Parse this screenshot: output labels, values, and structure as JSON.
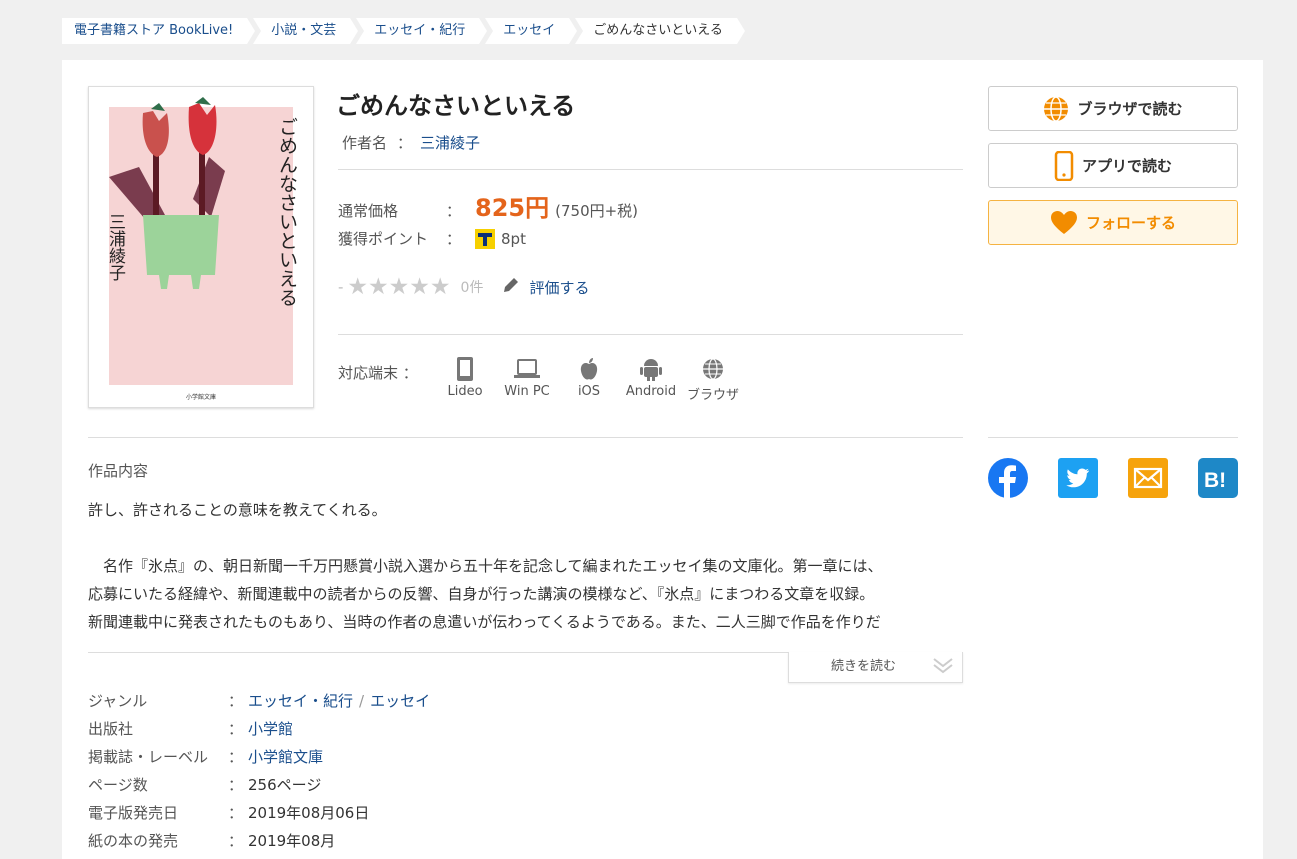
{
  "breadcrumb": [
    "電子書籍ストア BookLive!",
    "小説・文芸",
    "エッセイ・紀行",
    "エッセイ",
    "ごめんなさいといえる"
  ],
  "book": {
    "title": "ごめんなさいといえる",
    "author_label": "作者名",
    "author": "三浦綾子",
    "cover_title": "ごめんなさいといえる",
    "cover_author": "三浦綾子",
    "cover_publisher": "小学館文庫"
  },
  "price": {
    "label": "通常価格",
    "value": "825円",
    "tax": "(750円+税)",
    "points_label": "獲得ポイント",
    "points": "8pt"
  },
  "rating": {
    "dash": "-",
    "stars": "★★★★★",
    "count": "0件",
    "action": "評価する"
  },
  "devices": {
    "label": "対応端末",
    "items": [
      "Lideo",
      "Win PC",
      "iOS",
      "Android",
      "ブラウザ"
    ]
  },
  "description": {
    "heading": "作品内容",
    "lead": "許し、許されることの意味を教えてくれる。",
    "body_1": "名作『氷点』の、朝日新聞一千万円懸賞小説入選から五十年を記念して編まれたエッセイ集の文庫化。第一章には、",
    "body_2": "応募にいたる経緯や、新聞連載中の読者からの反響、自身が行った講演の模様など、『氷点』にまつわる文章を収録。",
    "body_3": "新聞連載中に発表されたものもあり、当時の作者の息遣いが伝わってくるようである。また、二人三脚で作品を作りだ",
    "more": "続きを読む"
  },
  "meta": [
    {
      "key": "ジャンル",
      "values": [
        "エッセイ・紀行",
        "エッセイ"
      ],
      "link": true
    },
    {
      "key": "出版社",
      "values": [
        "小学館"
      ],
      "link": true
    },
    {
      "key": "掲載誌・レーベル",
      "values": [
        "小学館文庫"
      ],
      "link": true
    },
    {
      "key": "ページ数",
      "values": [
        "256ページ"
      ],
      "link": false
    },
    {
      "key": "電子版発売日",
      "values": [
        "2019年08月06日"
      ],
      "link": false
    },
    {
      "key": "紙の本の発売",
      "values": [
        "2019年08月"
      ],
      "link": false
    }
  ],
  "buttons": {
    "browser": "ブラウザで読む",
    "app": "アプリで読む",
    "follow": "フォローする"
  },
  "colon": "：",
  "colors": {
    "accent_price": "#e4641b",
    "link": "#1a4e8c",
    "follow": "#f28c00",
    "facebook": "#1877f2",
    "twitter": "#1da1f2",
    "mail": "#f6a30c",
    "hatena": "#1e88c7"
  }
}
